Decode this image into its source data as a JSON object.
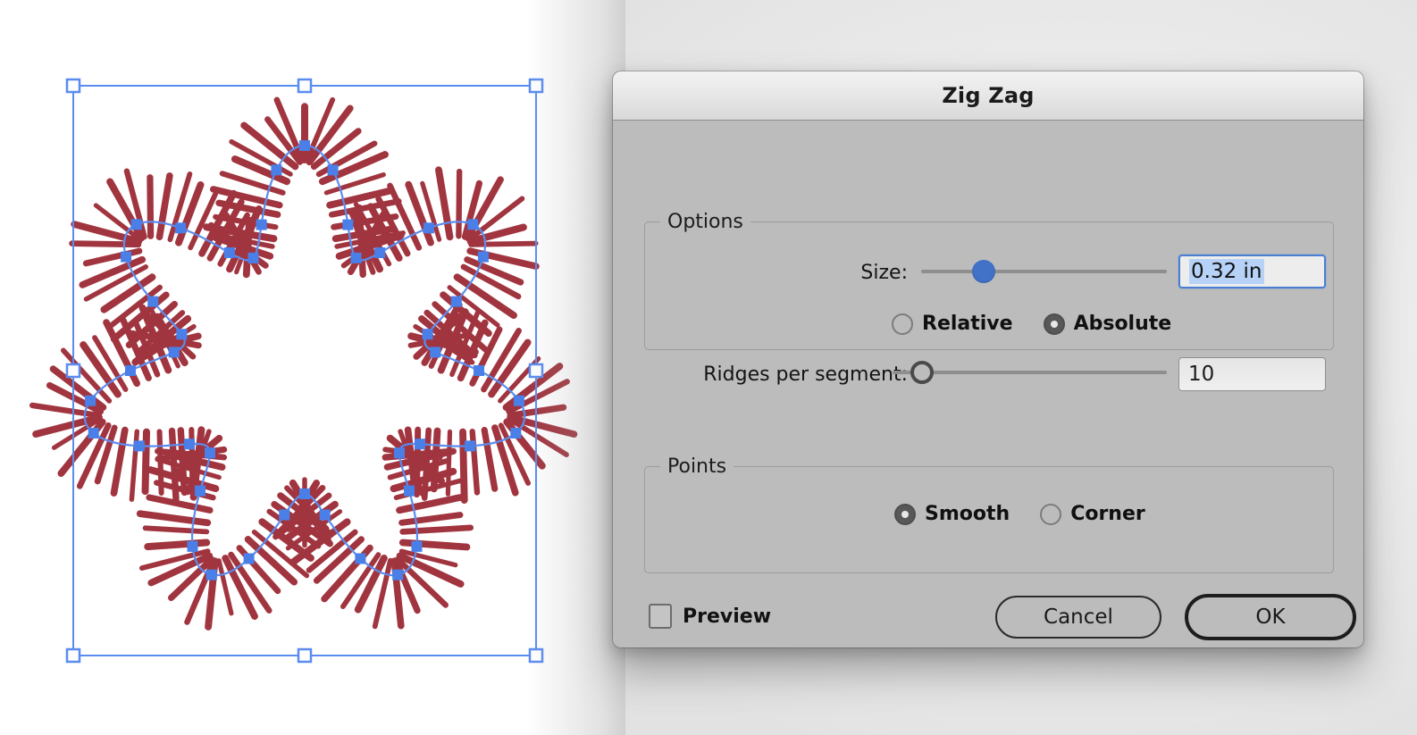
{
  "dialog": {
    "title": "Zig Zag",
    "options_group": {
      "label": "Options",
      "size_label": "Size:",
      "size_value": "0.32 in",
      "size_slider_percent": 23,
      "size_mode": [
        {
          "label": "Relative",
          "selected": false
        },
        {
          "label": "Absolute",
          "selected": true
        }
      ],
      "ridges_label": "Ridges per segment:",
      "ridges_value": "10",
      "ridges_slider_percent": 7
    },
    "points_group": {
      "label": "Points",
      "options": [
        {
          "label": "Smooth",
          "selected": true
        },
        {
          "label": "Corner",
          "selected": false
        }
      ]
    },
    "footer": {
      "preview_label": "Preview",
      "preview_checked": false,
      "cancel_label": "Cancel",
      "ok_label": "OK"
    }
  },
  "canvas": {
    "artwork_name": "zigzag-starburst-path",
    "artwork_color": "#9d2b35",
    "selection_color": "#5a8cf0",
    "anchor_color": "#4a7fe8",
    "background": "#ffffff"
  }
}
